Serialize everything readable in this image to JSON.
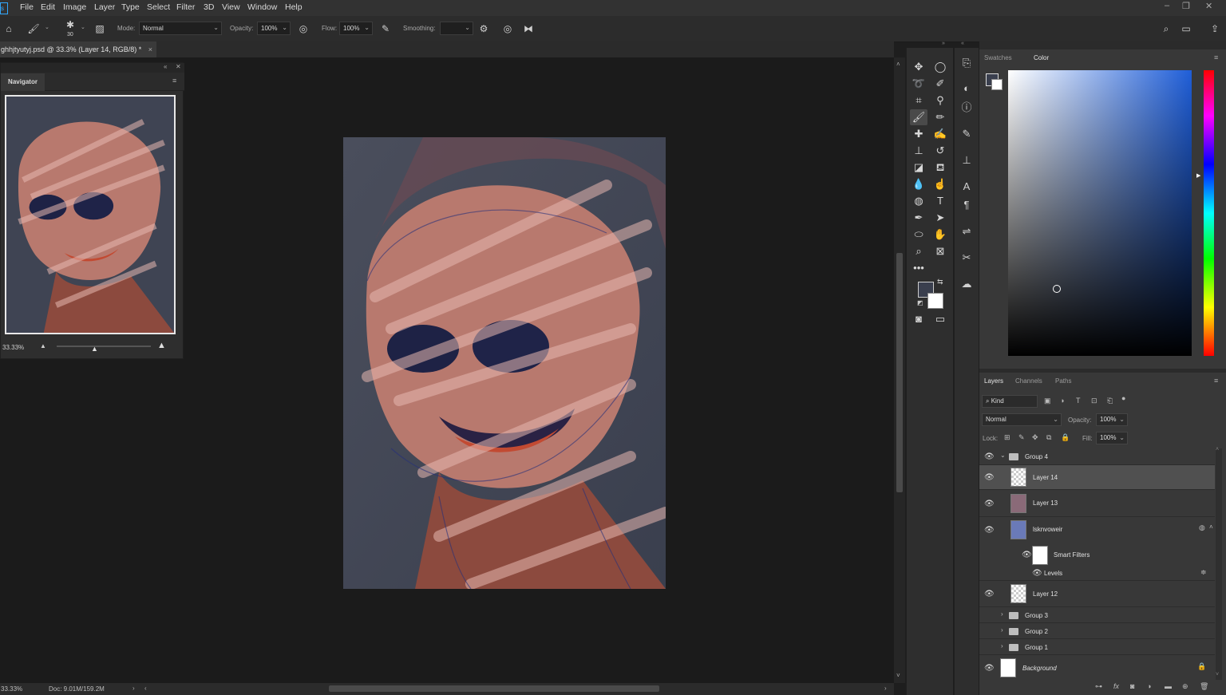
{
  "menu": [
    "File",
    "Edit",
    "Image",
    "Layer",
    "Type",
    "Select",
    "Filter",
    "3D",
    "View",
    "Window",
    "Help"
  ],
  "options": {
    "brush_size": "30",
    "mode_label": "Mode:",
    "mode_value": "Normal",
    "opacity_label": "Opacity:",
    "opacity_value": "100%",
    "flow_label": "Flow:",
    "flow_value": "100%",
    "smoothing_label": "Smoothing:",
    "smoothing_value": ""
  },
  "document_tab": {
    "title": "ghhjtyutyj.psd @ 33.3% (Layer 14, RGB/8) *",
    "close": "×"
  },
  "navigator": {
    "title": "Navigator",
    "zoom": "33.33%"
  },
  "status": {
    "zoom": "33.33%",
    "doc": "Doc: 9.01M/159.2M"
  },
  "color_panels": {
    "tabs": [
      "Swatches",
      "Color"
    ],
    "active": "Color"
  },
  "layers_panel": {
    "tabs": [
      "Layers",
      "Channels",
      "Paths"
    ],
    "filter_kind": "Kind",
    "blend_mode": "Normal",
    "opacity_label": "Opacity:",
    "opacity_value": "100%",
    "lock_label": "Lock:",
    "fill_label": "Fill:",
    "fill_value": "100%",
    "layers": [
      {
        "name": "Group 4",
        "type": "group",
        "visible": true,
        "expanded": true
      },
      {
        "name": "Layer 14",
        "type": "layer",
        "visible": true,
        "selected": true
      },
      {
        "name": "Layer 13",
        "type": "layer",
        "visible": true
      },
      {
        "name": "lsknvoweir",
        "type": "smart",
        "visible": true
      },
      {
        "name": "Smart Filters",
        "type": "filter-mask",
        "visible": true
      },
      {
        "name": "Levels",
        "type": "filter",
        "visible": true
      },
      {
        "name": "Layer 12",
        "type": "layer",
        "visible": true
      },
      {
        "name": "Group 3",
        "type": "group",
        "visible": false
      },
      {
        "name": "Group 2",
        "type": "group",
        "visible": false
      },
      {
        "name": "Group 1",
        "type": "group",
        "visible": false
      },
      {
        "name": "Background",
        "type": "background",
        "visible": true
      }
    ]
  },
  "colors": {
    "foreground": "#3a3f4e",
    "background": "#ffffff",
    "selection": "#505050"
  }
}
